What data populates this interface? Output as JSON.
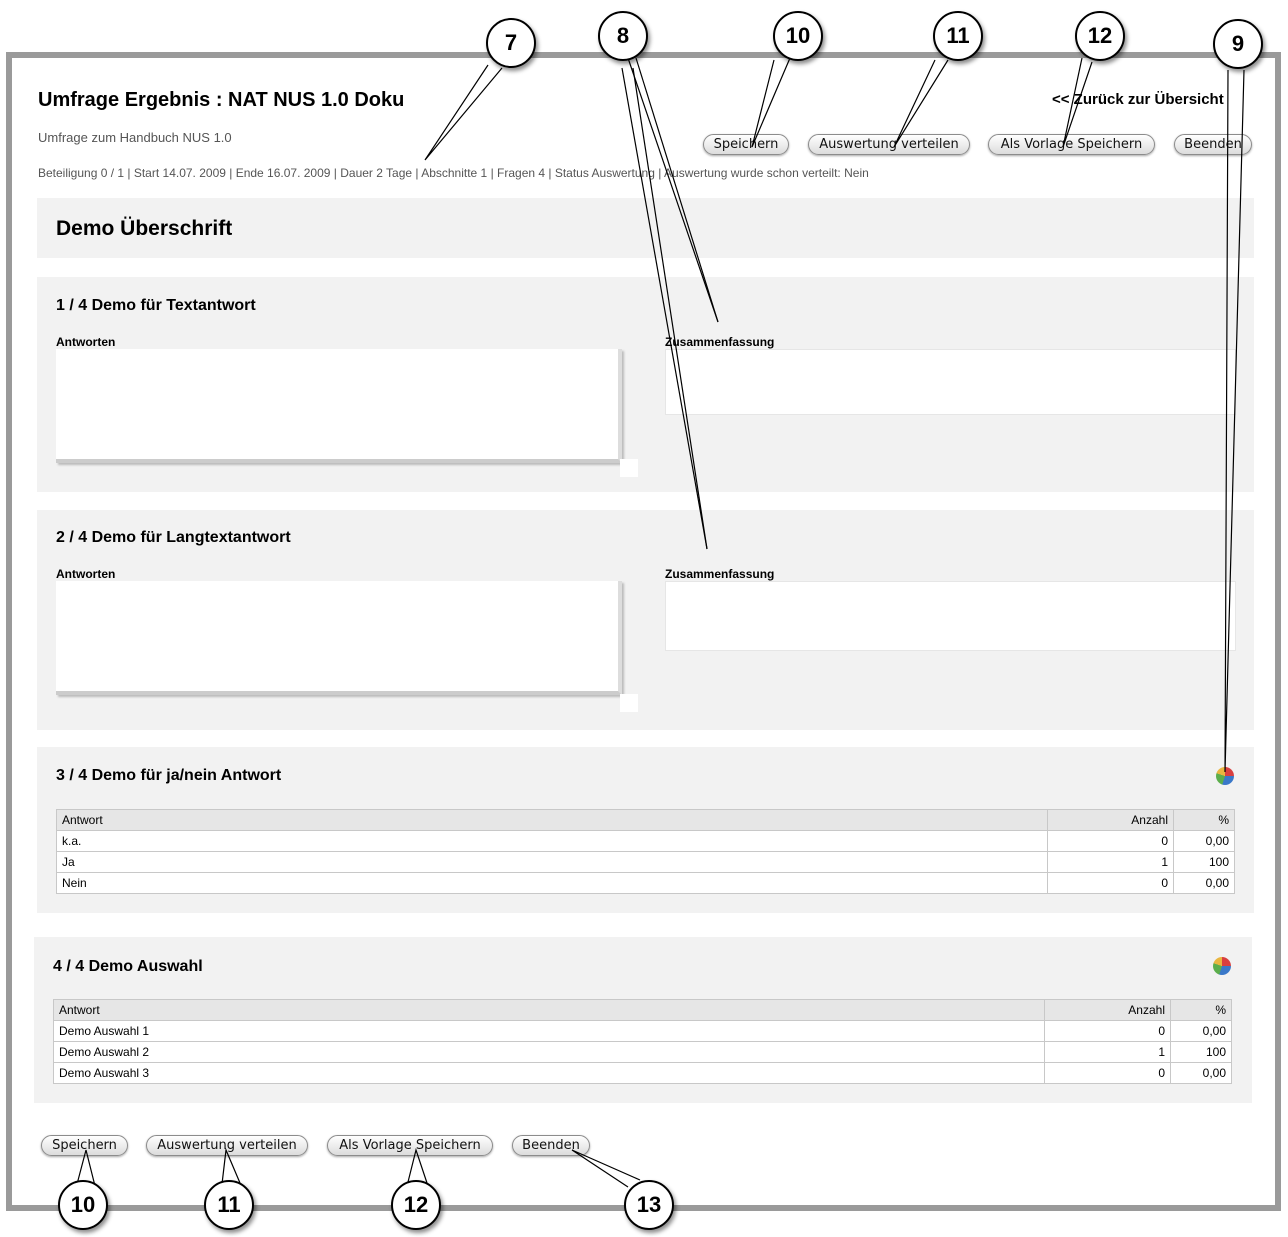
{
  "header": {
    "title": "Umfrage Ergebnis : NAT NUS 1.0 Doku",
    "subtitle": "Umfrage zum Handbuch NUS 1.0",
    "meta": "Beteiligung 0 / 1 | Start 14.07. 2009 | Ende 16.07. 2009 | Dauer 2 Tage | Abschnitte 1 | Fragen 4 | Status Auswertung | Auswertung wurde schon verteilt: Nein",
    "back_link": "<< Zurück zur Übersicht"
  },
  "toolbar": {
    "save": "Speichern",
    "distribute": "Auswertung verteilen",
    "save_template": "Als Vorlage Speichern",
    "finish": "Beenden"
  },
  "section_heading": "Demo Überschrift",
  "questions": [
    {
      "title": "1 / 4 Demo für Textantwort",
      "answers_label": "Antworten",
      "summary_label": "Zusammenfassung"
    },
    {
      "title": "2 / 4 Demo für Langtextantwort",
      "answers_label": "Antworten",
      "summary_label": "Zusammenfassung"
    },
    {
      "title": "3 / 4 Demo für ja/nein Antwort",
      "table": {
        "headers": [
          "Antwort",
          "Anzahl",
          "%"
        ],
        "rows": [
          [
            "k.a.",
            "0",
            "0,00"
          ],
          [
            "Ja",
            "1",
            "100"
          ],
          [
            "Nein",
            "0",
            "0,00"
          ]
        ]
      }
    },
    {
      "title": "4 / 4 Demo Auswahl",
      "table": {
        "headers": [
          "Antwort",
          "Anzahl",
          "%"
        ],
        "rows": [
          [
            "Demo Auswahl 1",
            "0",
            "0,00"
          ],
          [
            "Demo Auswahl 2",
            "1",
            "100"
          ],
          [
            "Demo Auswahl 3",
            "0",
            "0,00"
          ]
        ]
      }
    }
  ],
  "callouts": [
    "7",
    "8",
    "9",
    "10",
    "11",
    "12",
    "13"
  ],
  "icons": {
    "chart": "pie-chart-icon"
  },
  "colors": {
    "frame": "#9a9a9a",
    "panel": "#f2f2f2"
  }
}
